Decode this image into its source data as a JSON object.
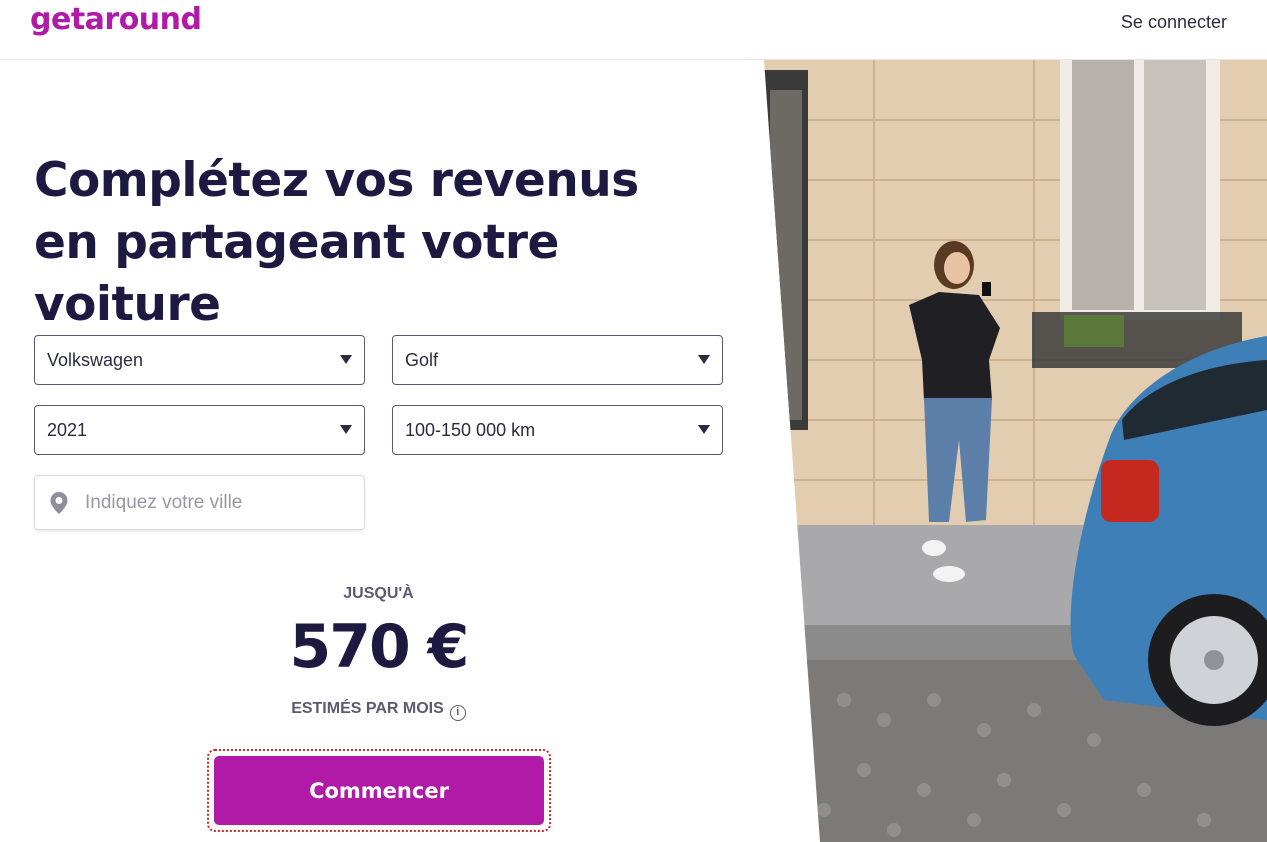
{
  "header": {
    "logo": "getaround",
    "login_label": "Se connecter"
  },
  "hero": {
    "title": "Complétez vos revenus en partageant votre voiture"
  },
  "form": {
    "make": "Volkswagen",
    "model": "Golf",
    "year": "2021",
    "mileage": "100-150 000 km",
    "city_placeholder": "Indiquez votre ville"
  },
  "estimate": {
    "upto_label": "JUSQU'À",
    "amount": "570 €",
    "per_month_label": "ESTIMÉS PAR MOIS"
  },
  "cta": {
    "label": "Commencer"
  },
  "colors": {
    "brand": "#b01aa7",
    "title": "#1d1941"
  },
  "icons": [
    "location-pin-icon",
    "info-icon",
    "caret-down-icon"
  ]
}
